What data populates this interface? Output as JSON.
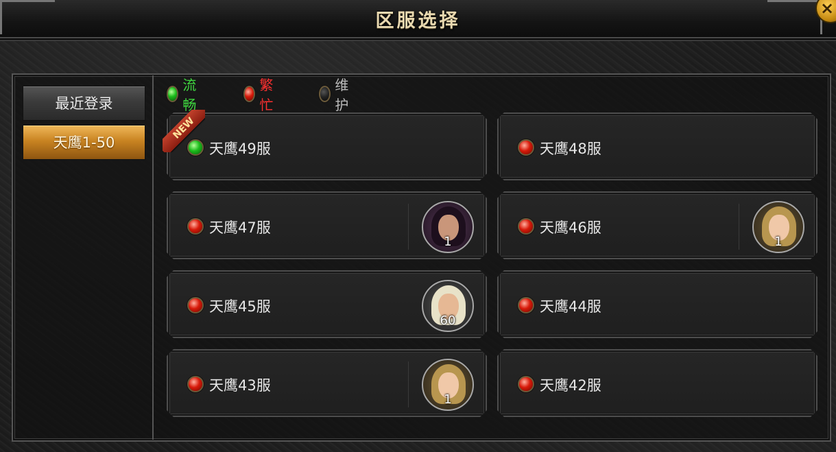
{
  "window": {
    "title": "区服选择",
    "close_glyph": "×"
  },
  "sidebar": {
    "tabs": [
      {
        "label": "最近登录",
        "active": false
      },
      {
        "label": "天鹰1-50",
        "active": true
      }
    ]
  },
  "legend": {
    "smooth": {
      "label": "流畅",
      "color": "#3fd63f"
    },
    "busy": {
      "label": "繁忙",
      "color": "#ff3030"
    },
    "maintenance": {
      "label": "维护",
      "color": "#bbbbbb"
    }
  },
  "badge_new": "NEW",
  "servers": [
    {
      "name": "天鹰49服",
      "status": "smooth",
      "is_new": true
    },
    {
      "name": "天鹰48服",
      "status": "busy"
    },
    {
      "name": "天鹰47服",
      "status": "busy",
      "character": {
        "level": "1",
        "portrait": "dark-haired"
      }
    },
    {
      "name": "天鹰46服",
      "status": "busy",
      "character": {
        "level": "1",
        "portrait": "blonde"
      }
    },
    {
      "name": "天鹰45服",
      "status": "busy",
      "character": {
        "level": "60",
        "portrait": "white-haired"
      }
    },
    {
      "name": "天鹰44服",
      "status": "busy"
    },
    {
      "name": "天鹰43服",
      "status": "busy",
      "character": {
        "level": "1",
        "portrait": "blonde"
      }
    },
    {
      "name": "天鹰42服",
      "status": "busy"
    }
  ]
}
